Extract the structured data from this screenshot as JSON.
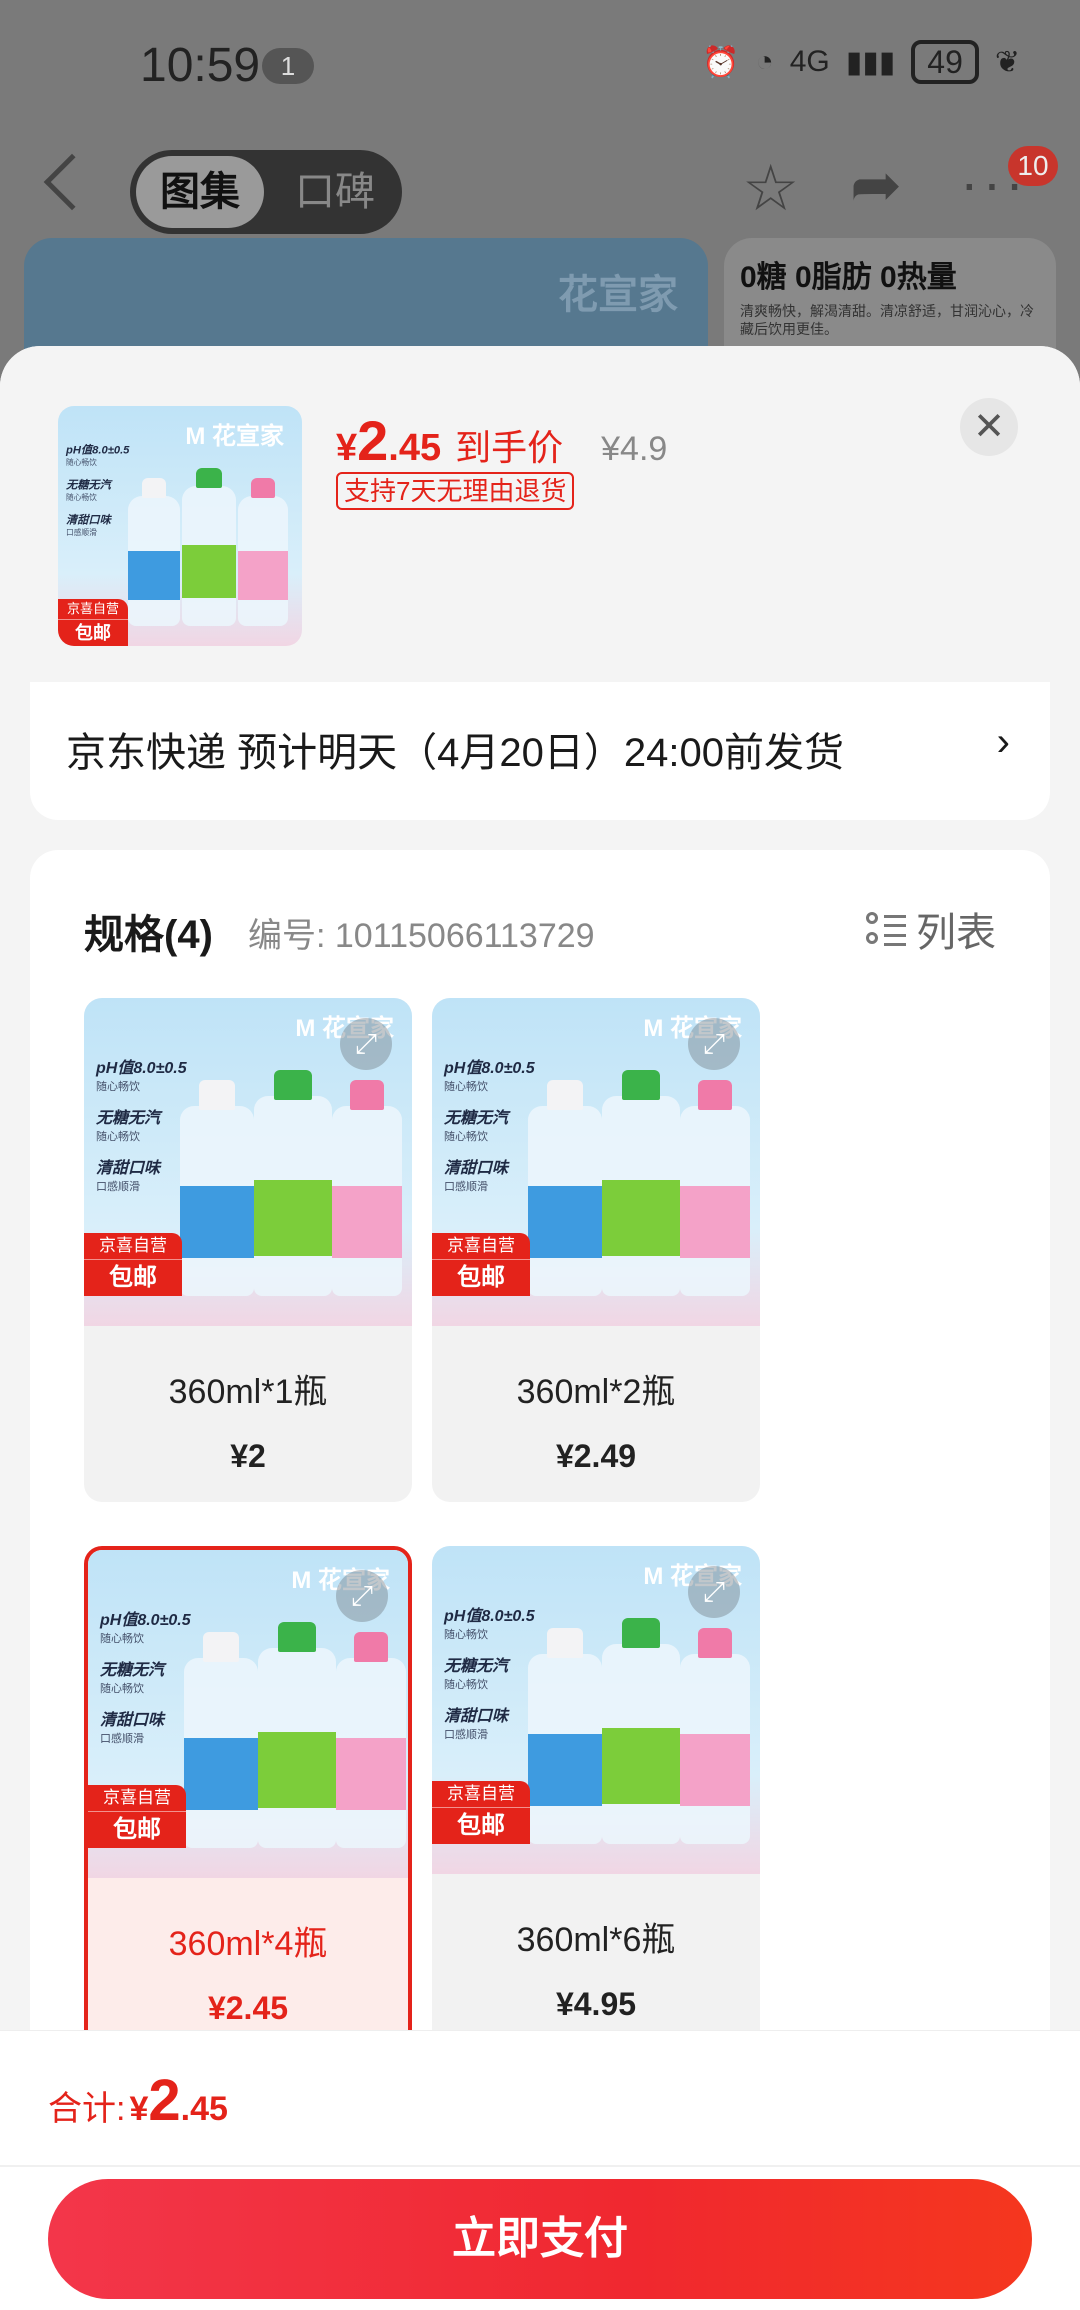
{
  "status_bar": {
    "time": "10:59",
    "notif_count": "1",
    "network": "4G",
    "battery": "49"
  },
  "background": {
    "tabs": [
      {
        "label": "图集",
        "active": true
      },
      {
        "label": "口碑",
        "active": false
      }
    ],
    "cart_badge": "10",
    "banner_brand": "花宣家",
    "banner_title": "0糖 0脂肪 0热量",
    "banner_sub": "清爽畅快，解渴清甜。清凉舒适，甘润沁心，冷藏后饮用更佳。"
  },
  "sheet": {
    "price_symbol": "¥",
    "price_int": "2",
    "price_dec": ".45",
    "price_label": "到手价",
    "original_price": "¥4.9",
    "return_policy": "支持7天无理由退货",
    "close_icon": "close-icon"
  },
  "delivery": {
    "text": "京东快递 预计明天（4月20日）24:00前发货",
    "arrow": "›"
  },
  "spec": {
    "title": "规格(4)",
    "code": "编号: 10115066113729",
    "list_toggle": "列表",
    "options": [
      {
        "label": "360ml*1瓶",
        "price": "¥2",
        "selected": false
      },
      {
        "label": "360ml*2瓶",
        "price": "¥2.49",
        "selected": false
      },
      {
        "label": "360ml*4瓶",
        "price": "¥2.45",
        "selected": true
      },
      {
        "label": "360ml*6瓶",
        "price": "¥4.95",
        "selected": false
      }
    ]
  },
  "product_image": {
    "brand": "M 花宣家",
    "lines": [
      {
        "head": "pH值8.0±0.5",
        "sub": "随心畅饮"
      },
      {
        "head": "无糖无汽",
        "sub": "随心畅饮"
      },
      {
        "head": "清甜口味",
        "sub": "口感顺滑"
      }
    ],
    "jd_tag_top": "京喜自营",
    "jd_tag_bottom": "包邮"
  },
  "footer": {
    "total_label": "合计:",
    "total_symbol": "¥",
    "total_int": "2",
    "total_dec": ".45",
    "pay_button": "立即支付"
  },
  "colors": {
    "accent": "#e4231a",
    "selected_bg": "#fdecea"
  }
}
